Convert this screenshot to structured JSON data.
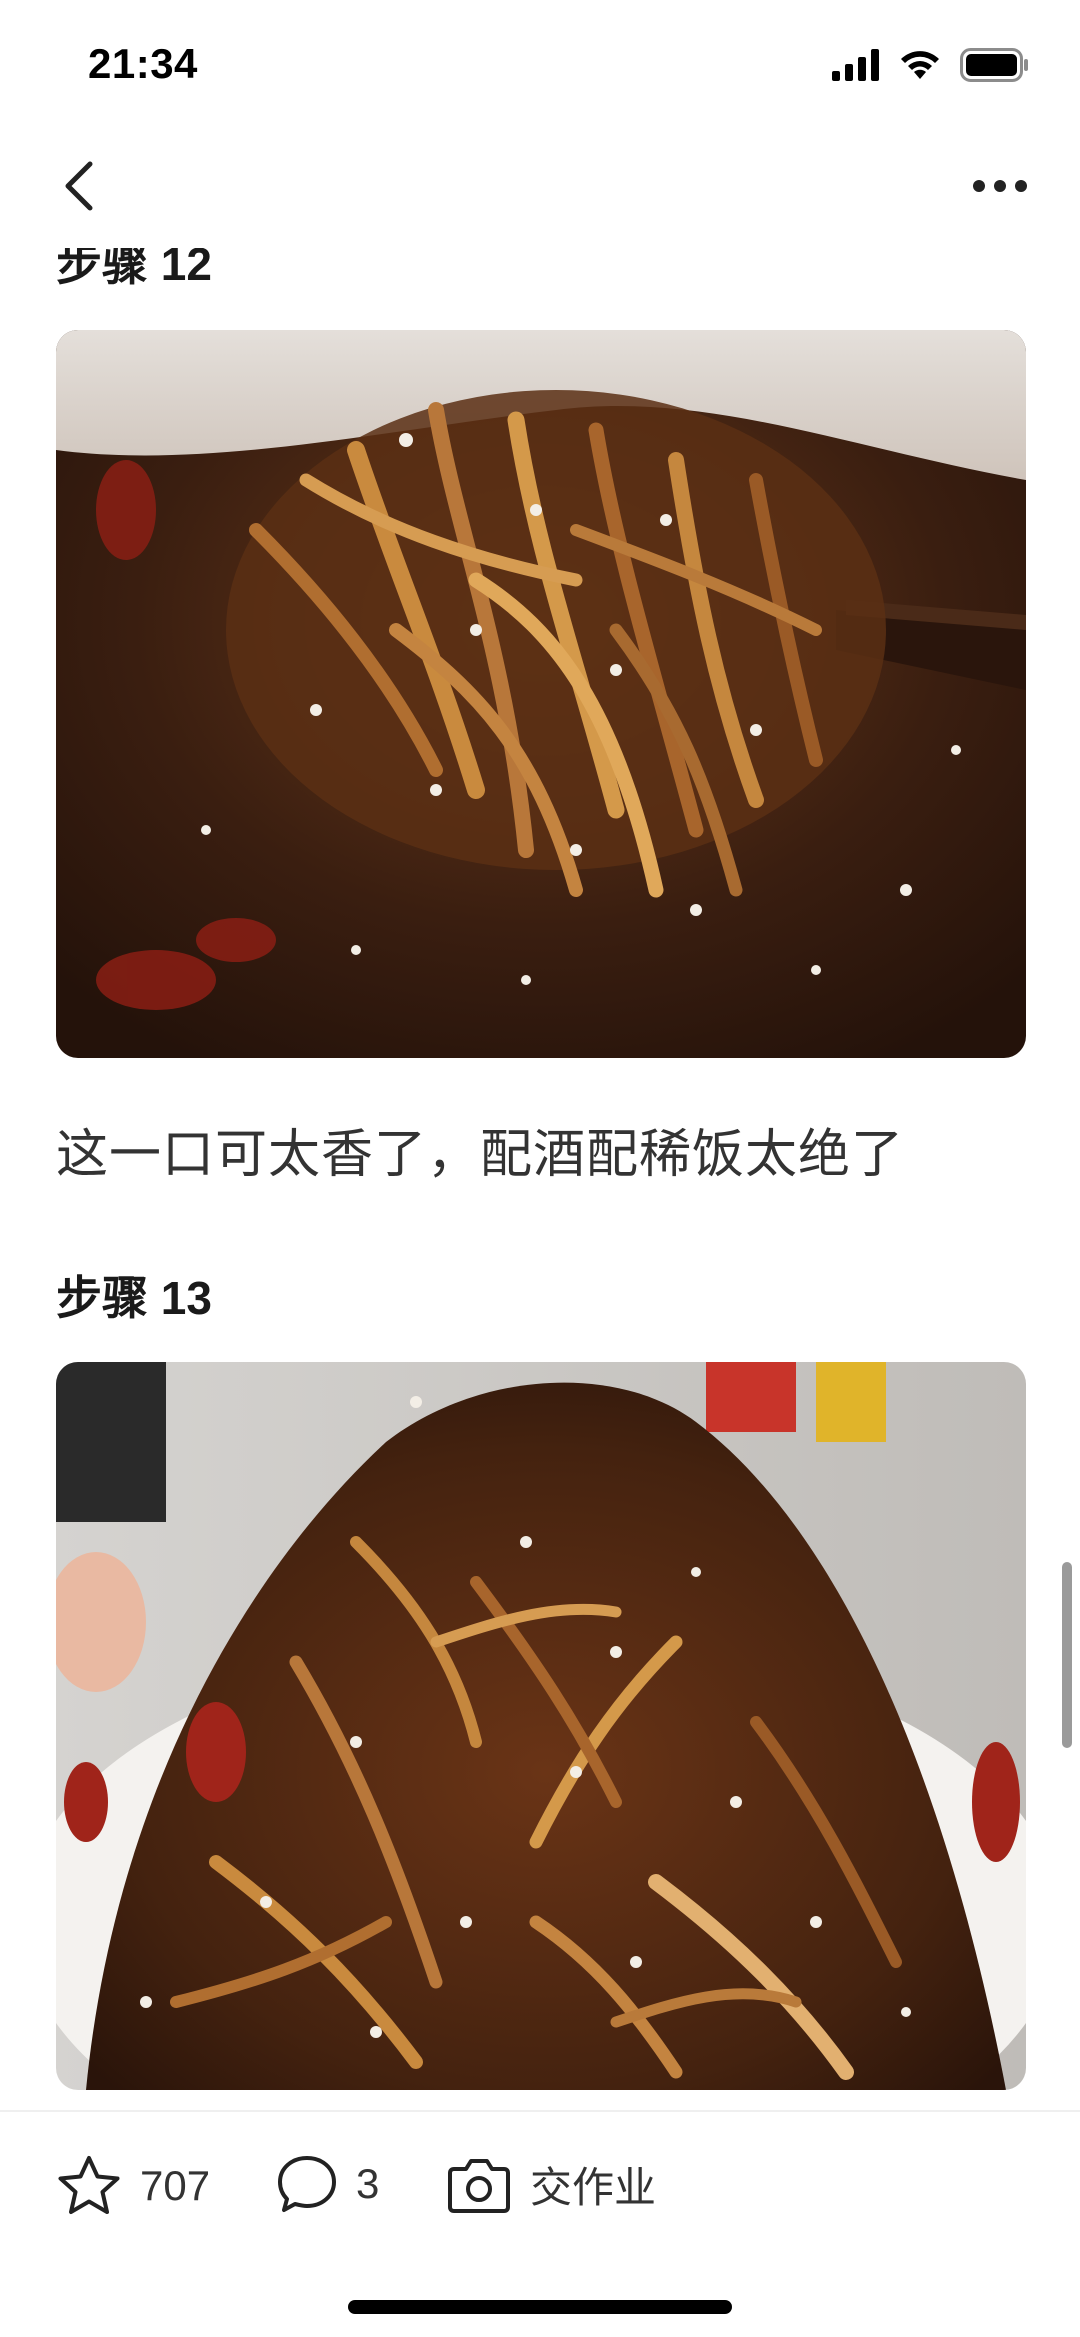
{
  "status_bar": {
    "time": "21:34"
  },
  "nav": {
    "back_icon": "chevron-left-icon",
    "more_icon": "more-horizontal-icon"
  },
  "steps": [
    {
      "title": "步骤 12",
      "description": "这一口可太香了，配酒配稀饭太绝了"
    },
    {
      "title": "步骤 13"
    }
  ],
  "bottom_bar": {
    "like_count": "707",
    "comment_count": "3",
    "submit_label": "交作业"
  },
  "colors": {
    "accent_text": "#1a1a1a",
    "food_dark": "#3a1e10",
    "food_light": "#b07a3a",
    "chili_red": "#a0241a"
  }
}
